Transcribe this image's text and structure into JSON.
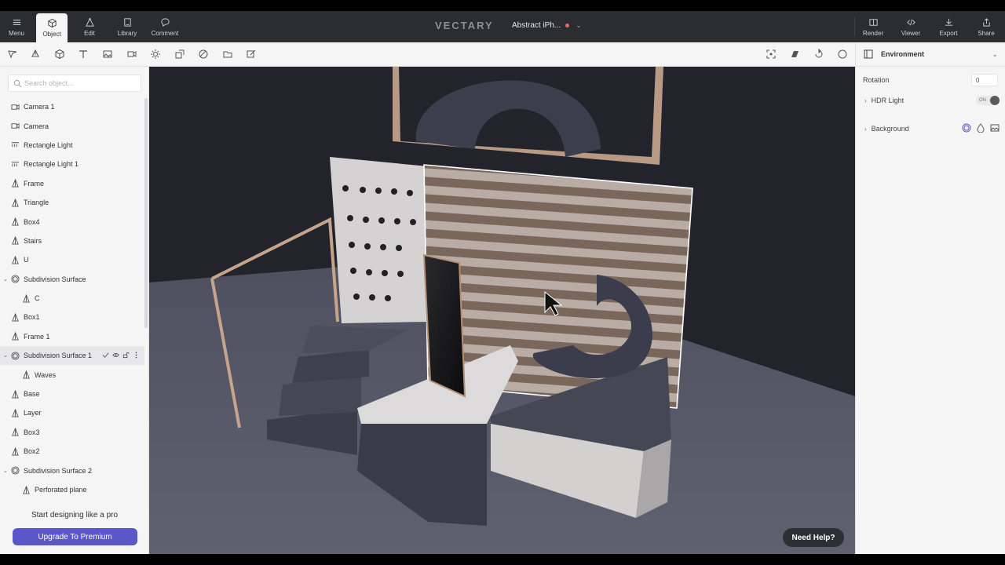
{
  "topbar": {
    "menu_label": "Menu",
    "object_label": "Object",
    "edit_label": "Edit",
    "library_label": "Library",
    "comment_label": "Comment",
    "logo": "VECTARY",
    "project_name": "Abstract iPh...",
    "render_label": "Render",
    "viewer_label": "Viewer",
    "export_label": "Export",
    "share_label": "Share"
  },
  "search": {
    "placeholder": "Search object..."
  },
  "objects": [
    {
      "label": "Camera 1",
      "icon": "camera-icon"
    },
    {
      "label": "Camera",
      "icon": "camera-icon"
    },
    {
      "label": "Rectangle Light",
      "icon": "rect-light-icon"
    },
    {
      "label": "Rectangle Light 1",
      "icon": "rect-light-icon"
    },
    {
      "label": "Frame",
      "icon": "mesh-icon"
    },
    {
      "label": "Triangle",
      "icon": "mesh-icon"
    },
    {
      "label": "Box4",
      "icon": "mesh-icon"
    },
    {
      "label": "Stairs",
      "icon": "mesh-icon"
    },
    {
      "label": "U",
      "icon": "mesh-icon"
    },
    {
      "label": "Subdivision Surface",
      "icon": "subdivision-icon"
    },
    {
      "label": "C",
      "icon": "mesh-icon"
    },
    {
      "label": "Box1",
      "icon": "mesh-icon"
    },
    {
      "label": "Frame 1",
      "icon": "mesh-icon"
    },
    {
      "label": "Subdivision Surface 1",
      "icon": "subdivision-icon"
    },
    {
      "label": "Waves",
      "icon": "mesh-icon"
    },
    {
      "label": "Base",
      "icon": "mesh-icon"
    },
    {
      "label": "Layer",
      "icon": "mesh-icon"
    },
    {
      "label": "Box3",
      "icon": "mesh-icon"
    },
    {
      "label": "Box2",
      "icon": "mesh-icon"
    },
    {
      "label": "Subdivision Surface 2",
      "icon": "subdivision-icon"
    },
    {
      "label": "Perforated plane",
      "icon": "mesh-icon"
    }
  ],
  "promo": {
    "text": "Start designing like a pro",
    "button": "Upgrade To Premium"
  },
  "help": {
    "label": "Need Help?"
  },
  "environment": {
    "title": "Environment",
    "rotation_label": "Rotation",
    "rotation_value": "0",
    "hdr_label": "HDR Light",
    "hdr_state": "ON",
    "background_label": "Background"
  },
  "colors": {
    "accent": "#5b57c9",
    "topbar": "#2c2d31",
    "panel": "#f5f5f6"
  }
}
